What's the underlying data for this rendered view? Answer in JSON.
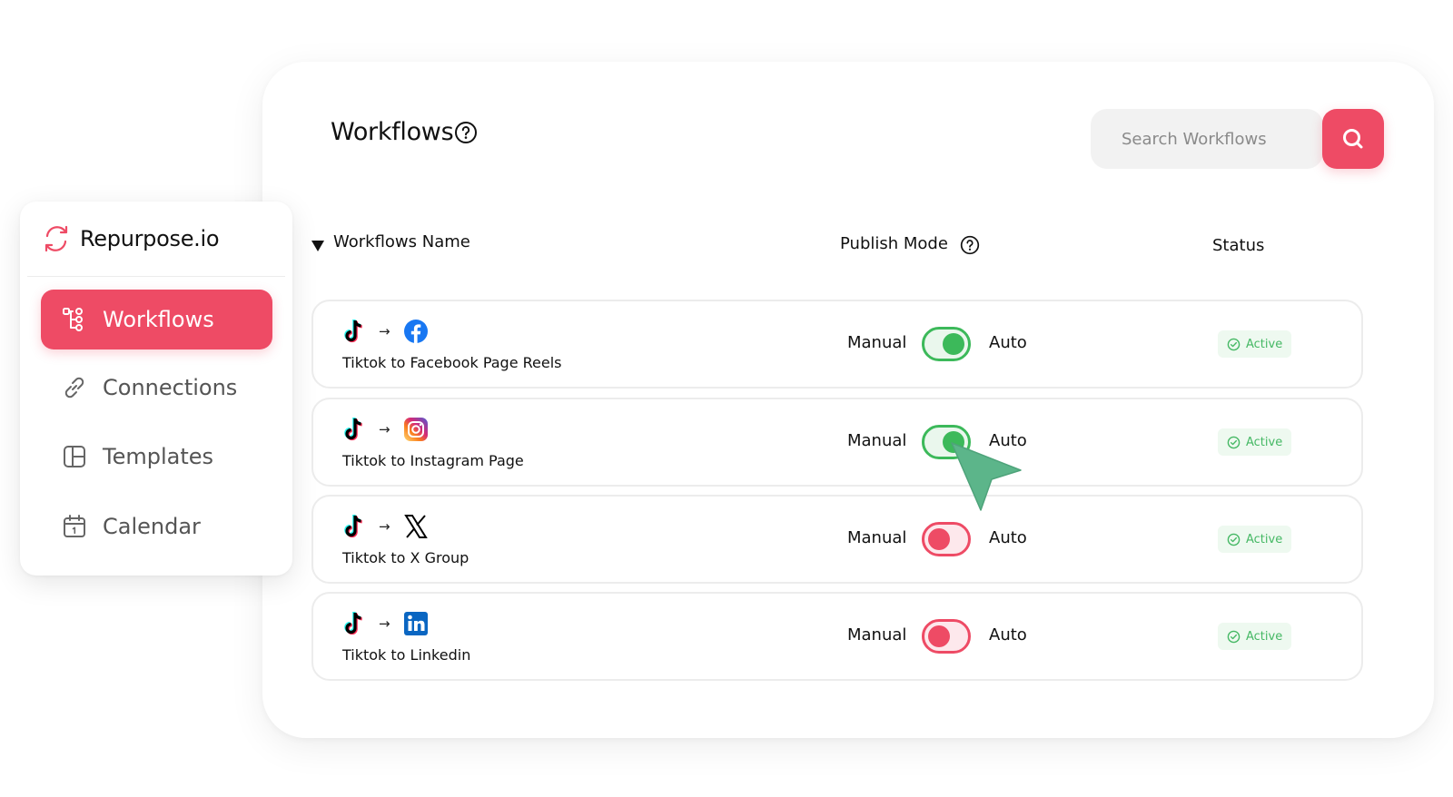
{
  "header": {
    "title": "Workflows"
  },
  "search": {
    "placeholder": "Search Workflows"
  },
  "table": {
    "columns": {
      "name": "Workflows Name",
      "publish_mode": "Publish Mode",
      "status": "Status"
    },
    "rows": [
      {
        "source_icon": "tiktok-icon",
        "arrow": "→",
        "target_icon": "facebook-icon",
        "name": "Tiktok to Facebook Page Reels",
        "manual_label": "Manual",
        "auto_label": "Auto",
        "auto_enabled": true,
        "status": "Active"
      },
      {
        "source_icon": "tiktok-icon",
        "arrow": "→",
        "target_icon": "instagram-icon",
        "name": "Tiktok to Instagram Page",
        "manual_label": "Manual",
        "auto_label": "Auto",
        "auto_enabled": true,
        "status": "Active"
      },
      {
        "source_icon": "tiktok-icon",
        "arrow": "→",
        "target_icon": "x-icon",
        "name": "Tiktok to X Group",
        "manual_label": "Manual",
        "auto_label": "Auto",
        "auto_enabled": false,
        "status": "Active"
      },
      {
        "source_icon": "tiktok-icon",
        "arrow": "→",
        "target_icon": "linkedin-icon",
        "name": "Tiktok to Linkedin",
        "manual_label": "Manual",
        "auto_label": "Auto",
        "auto_enabled": false,
        "status": "Active"
      }
    ]
  },
  "sidebar": {
    "brand": "Repurpose.io",
    "items": [
      {
        "label": "Workflows",
        "icon": "workflow-icon",
        "active": true
      },
      {
        "label": "Connections",
        "icon": "link-icon",
        "active": false
      },
      {
        "label": "Templates",
        "icon": "template-icon",
        "active": false
      },
      {
        "label": "Calendar",
        "icon": "calendar-icon",
        "active": false
      }
    ]
  },
  "colors": {
    "accent": "#ee4b65",
    "toggle_on": "#3cb95a",
    "status_active": "#45b864"
  }
}
